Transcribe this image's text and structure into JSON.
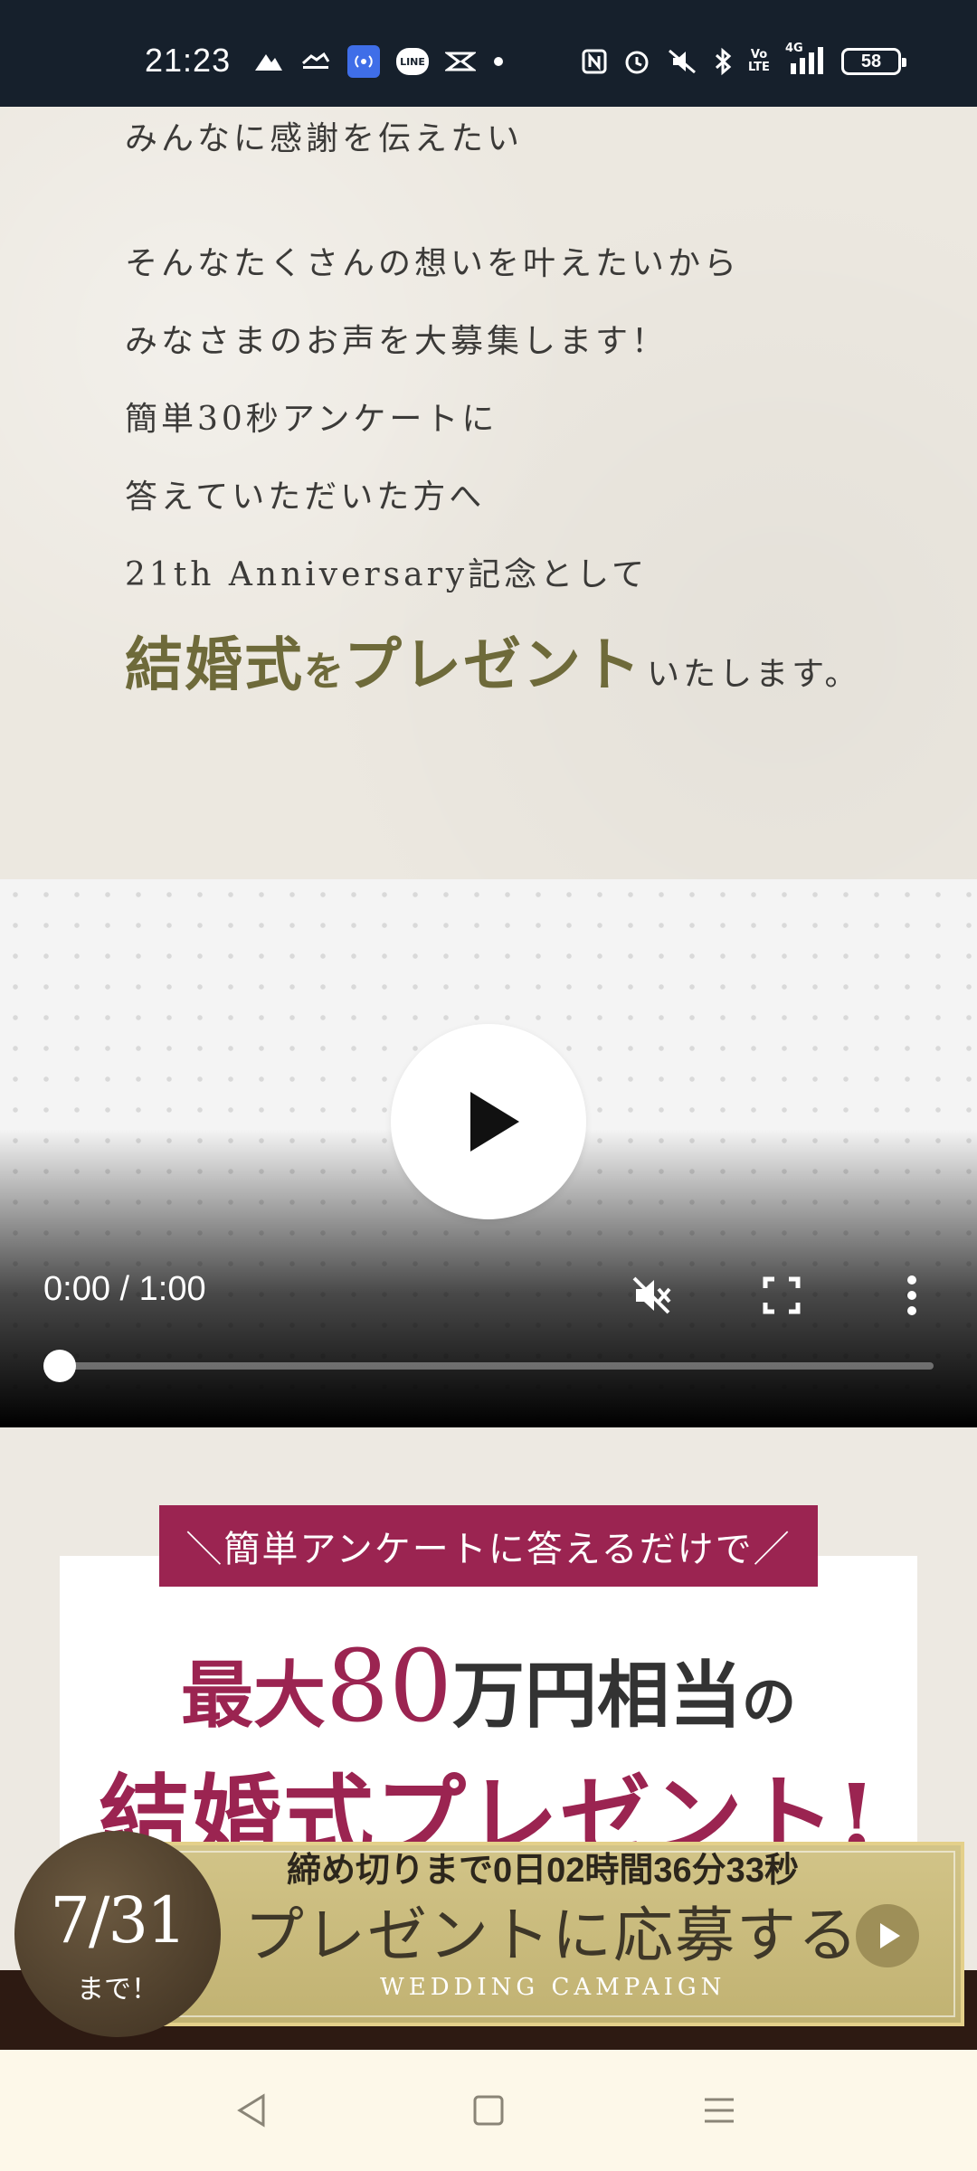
{
  "status_bar": {
    "time": "21:23",
    "battery": "58",
    "network": "4G",
    "volte": "Vo LTE",
    "icons": [
      "mountain-icon",
      "netkeiba-icon",
      "hotspot-icon",
      "line-icon",
      "app-icon",
      "dot-icon",
      "nfc-icon",
      "alarm-icon",
      "vibrate-mute-icon",
      "bluetooth-icon",
      "volte-icon",
      "signal-icon",
      "battery-icon"
    ],
    "line_label": "LINE"
  },
  "message": {
    "lines": [
      "みんなに感謝を伝えたい",
      "そんなたくさんの想いを叶えたいから",
      "みなさまのお声を大募集します！",
      "簡単30秒アンケートに",
      "答えていただいた方へ",
      "21th Anniversary記念として"
    ],
    "headline_part1": "結婚式",
    "headline_part2": "を",
    "headline_part3": "プレゼント",
    "headline_tail": "いたします。"
  },
  "video": {
    "time": "0:00 / 1:00",
    "progress": 0
  },
  "promo": {
    "ribbon": "＼簡単アンケートに答えるだけで／",
    "line1_a": "最大",
    "line1_num": "80",
    "line1_b": "万円相当",
    "line1_c": "の",
    "line2": "結婚式プレゼント!"
  },
  "cta": {
    "deadline": "締め切りまで0日02時間36分33秒",
    "main": "プレゼントに応募する",
    "sub": "WEDDING CAMPAIGN",
    "badge_date": "7/31",
    "badge_suffix": "まで！"
  },
  "colors": {
    "accent": "#9b2451",
    "gold": "#6e6a3a",
    "status_bar": "#16202c"
  }
}
